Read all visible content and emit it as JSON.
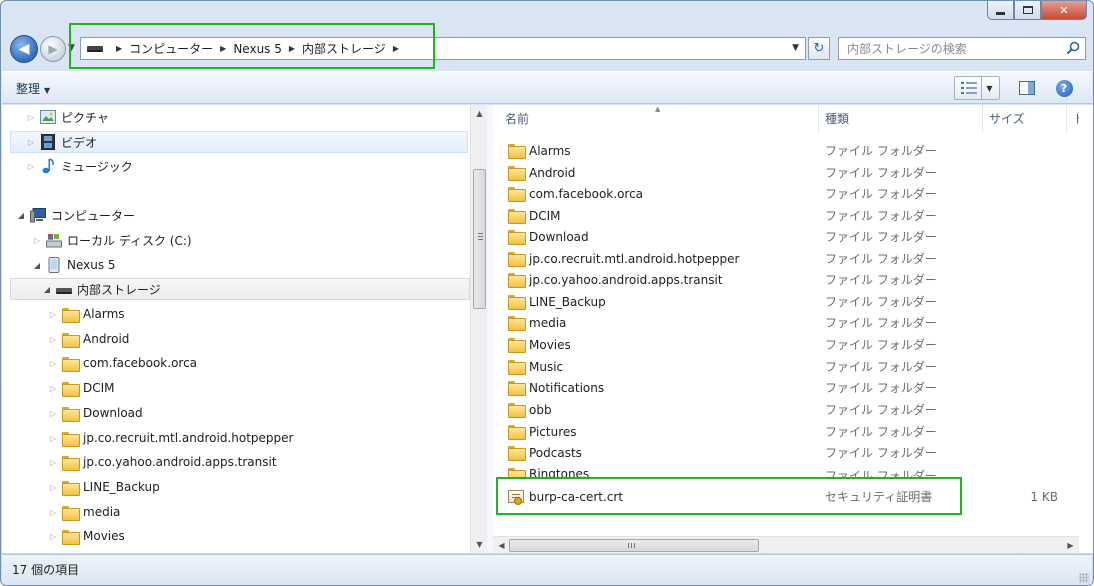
{
  "window": {
    "controls": {
      "minimize": "▭",
      "maximize": "□",
      "close": "✕"
    }
  },
  "address_bar": {
    "crumbs": [
      "コンピューター",
      "Nexus 5",
      "内部ストレージ"
    ]
  },
  "search": {
    "placeholder": "内部ストレージの検索"
  },
  "toolbar": {
    "organize_label": "整理"
  },
  "nav_tree": {
    "items": [
      {
        "label": "ピクチャ",
        "icon": "pictures-icon"
      },
      {
        "label": "ビデオ",
        "icon": "video-icon"
      },
      {
        "label": "ミュージック",
        "icon": "music-icon"
      },
      {
        "label": "コンピューター",
        "icon": "computer-icon"
      },
      {
        "label": "ローカル ディスク (C:)",
        "icon": "local-disk-icon"
      },
      {
        "label": "Nexus 5",
        "icon": "phone-icon"
      },
      {
        "label": "内部ストレージ",
        "icon": "storage-icon"
      },
      {
        "label": "Alarms",
        "icon": "folder-icon"
      },
      {
        "label": "Android",
        "icon": "folder-icon"
      },
      {
        "label": "com.facebook.orca",
        "icon": "folder-icon"
      },
      {
        "label": "DCIM",
        "icon": "folder-icon"
      },
      {
        "label": "Download",
        "icon": "folder-icon"
      },
      {
        "label": "jp.co.recruit.mtl.android.hotpepper",
        "icon": "folder-icon"
      },
      {
        "label": "jp.co.yahoo.android.apps.transit",
        "icon": "folder-icon"
      },
      {
        "label": "LINE_Backup",
        "icon": "folder-icon"
      },
      {
        "label": "media",
        "icon": "folder-icon"
      },
      {
        "label": "Movies",
        "icon": "folder-icon"
      }
    ]
  },
  "file_list": {
    "columns": {
      "name": "名前",
      "type": "種類",
      "size": "サイズ",
      "extra": "ト"
    },
    "rows": [
      {
        "name": "Alarms",
        "type": "ファイル フォルダー",
        "size": ""
      },
      {
        "name": "Android",
        "type": "ファイル フォルダー",
        "size": ""
      },
      {
        "name": "com.facebook.orca",
        "type": "ファイル フォルダー",
        "size": ""
      },
      {
        "name": "DCIM",
        "type": "ファイル フォルダー",
        "size": ""
      },
      {
        "name": "Download",
        "type": "ファイル フォルダー",
        "size": ""
      },
      {
        "name": "jp.co.recruit.mtl.android.hotpepper",
        "type": "ファイル フォルダー",
        "size": ""
      },
      {
        "name": "jp.co.yahoo.android.apps.transit",
        "type": "ファイル フォルダー",
        "size": ""
      },
      {
        "name": "LINE_Backup",
        "type": "ファイル フォルダー",
        "size": ""
      },
      {
        "name": "media",
        "type": "ファイル フォルダー",
        "size": ""
      },
      {
        "name": "Movies",
        "type": "ファイル フォルダー",
        "size": ""
      },
      {
        "name": "Music",
        "type": "ファイル フォルダー",
        "size": ""
      },
      {
        "name": "Notifications",
        "type": "ファイル フォルダー",
        "size": ""
      },
      {
        "name": "obb",
        "type": "ファイル フォルダー",
        "size": ""
      },
      {
        "name": "Pictures",
        "type": "ファイル フォルダー",
        "size": ""
      },
      {
        "name": "Podcasts",
        "type": "ファイル フォルダー",
        "size": ""
      },
      {
        "name": "Ringtones",
        "type": "ファイル フォルダー",
        "size": ""
      },
      {
        "name": "burp-ca-cert.crt",
        "type": "セキュリティ証明書",
        "size": "1 KB"
      }
    ]
  },
  "status_bar": {
    "text": "17 個の項目"
  },
  "colors": {
    "highlight": "#22b322",
    "accent": "#2f6cc0"
  }
}
